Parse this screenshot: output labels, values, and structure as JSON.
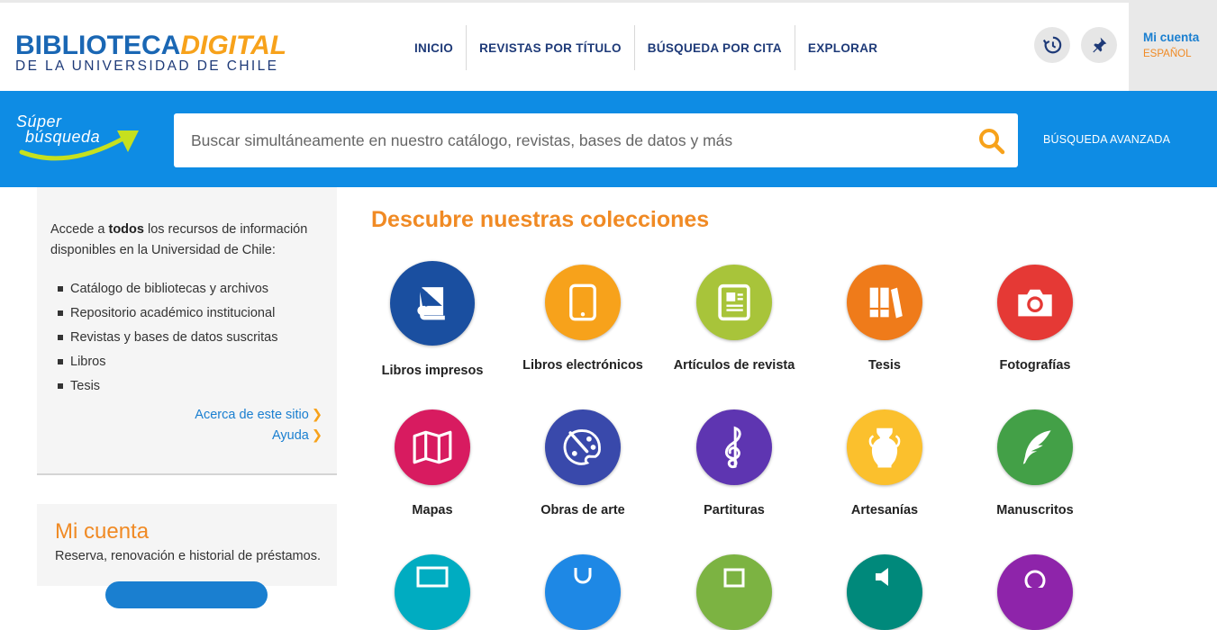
{
  "header": {
    "logo": {
      "line1_a": "BIBLIOTECA",
      "line1_b": "DIGITAL",
      "line2": "DE LA UNIVERSIDAD DE CHILE"
    },
    "nav": [
      "INICIO",
      "REVISTAS POR TÍTULO",
      "BÚSQUEDA POR CITA",
      "EXPLORAR"
    ],
    "history_icon": "history-icon",
    "pin_icon": "pin-icon",
    "account": {
      "title": "Mi cuenta",
      "language": "ESPAÑOL"
    }
  },
  "searchbar": {
    "brand_line1": "Súper",
    "brand_line2": "búsqueda",
    "placeholder": "Buscar simultáneamente en nuestro catálogo, revistas, bases de datos y más",
    "advanced": "BÚSQUEDA AVANZADA"
  },
  "sidebar": {
    "intro_pre": "Accede a ",
    "intro_bold": "todos",
    "intro_post": " los recursos de información disponibles en la Universidad de Chile:",
    "items": [
      "Catálogo de bibliotecas y archivos",
      "Repositorio académico institucional",
      "Revistas y bases de datos suscritas",
      "Libros",
      "Tesis"
    ],
    "link_about": "Acerca de este sitio",
    "link_help": "Ayuda"
  },
  "account_box": {
    "title": "Mi cuenta",
    "text": "Reserva, renovación e historial de préstamos."
  },
  "main": {
    "title": "Descubre nuestras colecciones",
    "collections": [
      {
        "label": "Libros impresos",
        "color": "#1a4fa0",
        "icon": "book-icon"
      },
      {
        "label": "Libros electrónicos",
        "color": "#f7a21b",
        "icon": "tablet-icon"
      },
      {
        "label": "Artículos de revista",
        "color": "#a8c43a",
        "icon": "article-icon"
      },
      {
        "label": "Tesis",
        "color": "#ef7b1a",
        "icon": "books-icon"
      },
      {
        "label": "Fotografías",
        "color": "#e53935",
        "icon": "camera-icon"
      },
      {
        "label": "Mapas",
        "color": "#d81b60",
        "icon": "map-icon"
      },
      {
        "label": "Obras de arte",
        "color": "#3949ab",
        "icon": "palette-icon"
      },
      {
        "label": "Partituras",
        "color": "#5e35b1",
        "icon": "music-icon"
      },
      {
        "label": "Artesanías",
        "color": "#fbc02d",
        "icon": "vase-icon"
      },
      {
        "label": "Manuscritos",
        "color": "#43a047",
        "icon": "feather-icon"
      },
      {
        "color": "#00acc1",
        "icon": "partial-icon"
      },
      {
        "color": "#1e88e5",
        "icon": "partial-icon"
      },
      {
        "color": "#7cb342",
        "icon": "partial-icon"
      },
      {
        "color": "#00897b",
        "icon": "partial-icon"
      },
      {
        "color": "#8e24aa",
        "icon": "partial-icon"
      }
    ]
  }
}
